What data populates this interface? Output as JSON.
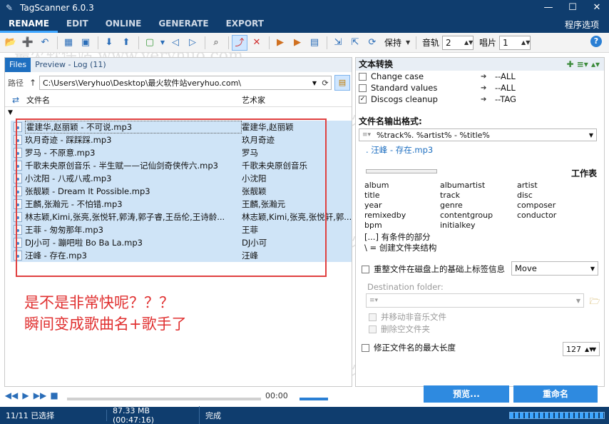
{
  "window": {
    "title": "TagScanner 6.0.3"
  },
  "menu": {
    "tabs": [
      "RENAME",
      "EDIT",
      "ONLINE",
      "GENERATE",
      "EXPORT"
    ],
    "options": "程序选项"
  },
  "toolbar": {
    "preserve": "保持",
    "track_label": "音轨",
    "track_value": "2",
    "disc_label": "唱片",
    "disc_value": "1"
  },
  "left": {
    "tabs": [
      "Files",
      "Preview - Log (11)"
    ],
    "path_label": "路径",
    "path": "C:\\Users\\Veryhuo\\Desktop\\最火软件站veryhuo.com\\",
    "col_filename": "文件名",
    "col_artist": "艺术家"
  },
  "files": [
    {
      "name": "霍建华,赵丽颖 - 不可说.mp3",
      "artist": "霍建华,赵丽颖"
    },
    {
      "name": "玖月奇迹 - 踩踩踩.mp3",
      "artist": "玖月奇迹"
    },
    {
      "name": "罗马 - 不原意.mp3",
      "artist": "罗马"
    },
    {
      "name": "千歌未央原创音乐 - 半生赋——记仙剑奇侠传六.mp3",
      "artist": "千歌未央原创音乐"
    },
    {
      "name": "小沈阳 - 八戒八戒.mp3",
      "artist": "小沈阳"
    },
    {
      "name": "张靓颖 - Dream It Possible.mp3",
      "artist": "张靓颖"
    },
    {
      "name": "王麟,张瀚元 - 不怕错.mp3",
      "artist": "王麟,张瀚元"
    },
    {
      "name": "林志颖,Kimi,张亮,张悦轩,郭涛,郭子睿,王岳伦,王诗龄...",
      "artist": "林志颖,Kimi,张亮,张悦轩,郭..."
    },
    {
      "name": "王菲 - 匆匆那年.mp3",
      "artist": "王菲"
    },
    {
      "name": "DJ小可 - 蹦吧啦 Bo Ba La.mp3",
      "artist": "DJ小可"
    },
    {
      "name": "汪峰 - 存在.mp3",
      "artist": "汪峰"
    }
  ],
  "annotation": {
    "line1": "是不是非常快呢？？？",
    "line2": "瞬间变成歌曲名+歌手了"
  },
  "player": {
    "time": "00:00"
  },
  "right": {
    "text_convert": "文本转换",
    "rules": [
      {
        "name": "Change case",
        "target": "--ALL",
        "checked": false
      },
      {
        "name": "Standard values",
        "target": "--ALL",
        "checked": false
      },
      {
        "name": "Discogs cleanup",
        "target": "--TAG",
        "checked": true
      }
    ],
    "format_label": "文件名输出格式:",
    "format_value": "%track%. %artist% - %title%",
    "preview": ". 汪峰 - 存在.mp3",
    "worktable": "工作表",
    "fields": [
      "album",
      "albumartist",
      "artist",
      "title",
      "track",
      "disc",
      "year",
      "genre",
      "composer",
      "remixedby",
      "contentgroup",
      "conductor",
      "bpm",
      "initialkey"
    ],
    "hint1": "[...] 有条件的部分",
    "hint2": "\\ = 创建文件夹结构",
    "restructure": "重整文件在磁盘上的基础上标签信息",
    "move": "Move",
    "dest_label": "Destination folder:",
    "move_nonmusic": "并移动非音乐文件",
    "delete_empty": "删除空文件夹",
    "max_len": "修正文件名的最大长度",
    "max_len_value": "127",
    "preview_btn": "预览...",
    "rename_btn": "重命名"
  },
  "status": {
    "selected": "11/11 已选择",
    "size": "87.33 MB (00:47:16)",
    "state": "完成"
  },
  "watermark": "最火软件站 www.veryhuo.com"
}
